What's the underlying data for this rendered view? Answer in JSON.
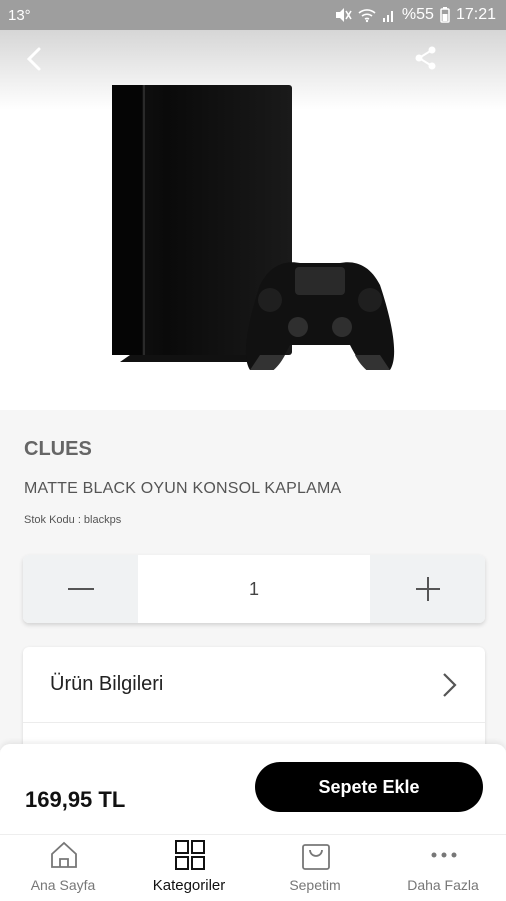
{
  "status_bar": {
    "left": "13°",
    "battery": "%55",
    "time": "17:21"
  },
  "product": {
    "brand": "CLUES",
    "name": "MATTE BLACK OYUN KONSOL KAPLAMA",
    "sku": "Stok Kodu : blackps"
  },
  "quantity": {
    "value": "1"
  },
  "info": {
    "label": "Ürün Bilgileri"
  },
  "cart": {
    "price": "169,95 TL",
    "button": "Sepete Ekle"
  },
  "tabs": [
    {
      "label": "Ana Sayfa",
      "icon": "home-icon"
    },
    {
      "label": "Kategoriler",
      "icon": "grid-icon"
    },
    {
      "label": "Sepetim",
      "icon": "bag-icon"
    },
    {
      "label": "Daha Fazla",
      "icon": "more-icon"
    }
  ]
}
